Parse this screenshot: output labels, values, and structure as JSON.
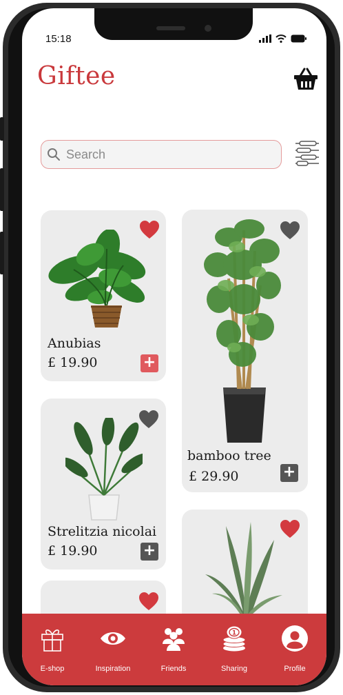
{
  "status_bar": {
    "time": "15:18"
  },
  "header": {
    "logo": "Giftee"
  },
  "search": {
    "placeholder": "Search"
  },
  "products": [
    {
      "name": "Anubias",
      "price": "£ 19.90",
      "favorite": true,
      "plant_icon": "leafy-plant"
    },
    {
      "name": "bamboo tree",
      "price": "£ 29.90",
      "favorite": false,
      "plant_icon": "bamboo-tree"
    },
    {
      "name": "Strelitzia nicolai",
      "price": "£ 19.90",
      "favorite": false,
      "plant_icon": "strelitzia"
    },
    {
      "name": "",
      "price": "",
      "favorite": true,
      "plant_icon": "snake-plant"
    },
    {
      "name": "",
      "price": "",
      "favorite": true,
      "plant_icon": ""
    }
  ],
  "nav": [
    {
      "label": "E-shop",
      "icon": "gift-icon"
    },
    {
      "label": "Inspiration",
      "icon": "eye-icon"
    },
    {
      "label": "Friends",
      "icon": "people-icon"
    },
    {
      "label": "Sharing",
      "icon": "coins-icon"
    },
    {
      "label": "Profile",
      "icon": "profile-icon"
    }
  ],
  "colors": {
    "brand": "#c9393c",
    "heart_active": "#d33a3f",
    "heart_inactive": "#555555",
    "plus_active": "#e05a5e",
    "plus_inactive": "#555555",
    "card_bg": "#ececec",
    "navbar": "#cc3b3d"
  }
}
